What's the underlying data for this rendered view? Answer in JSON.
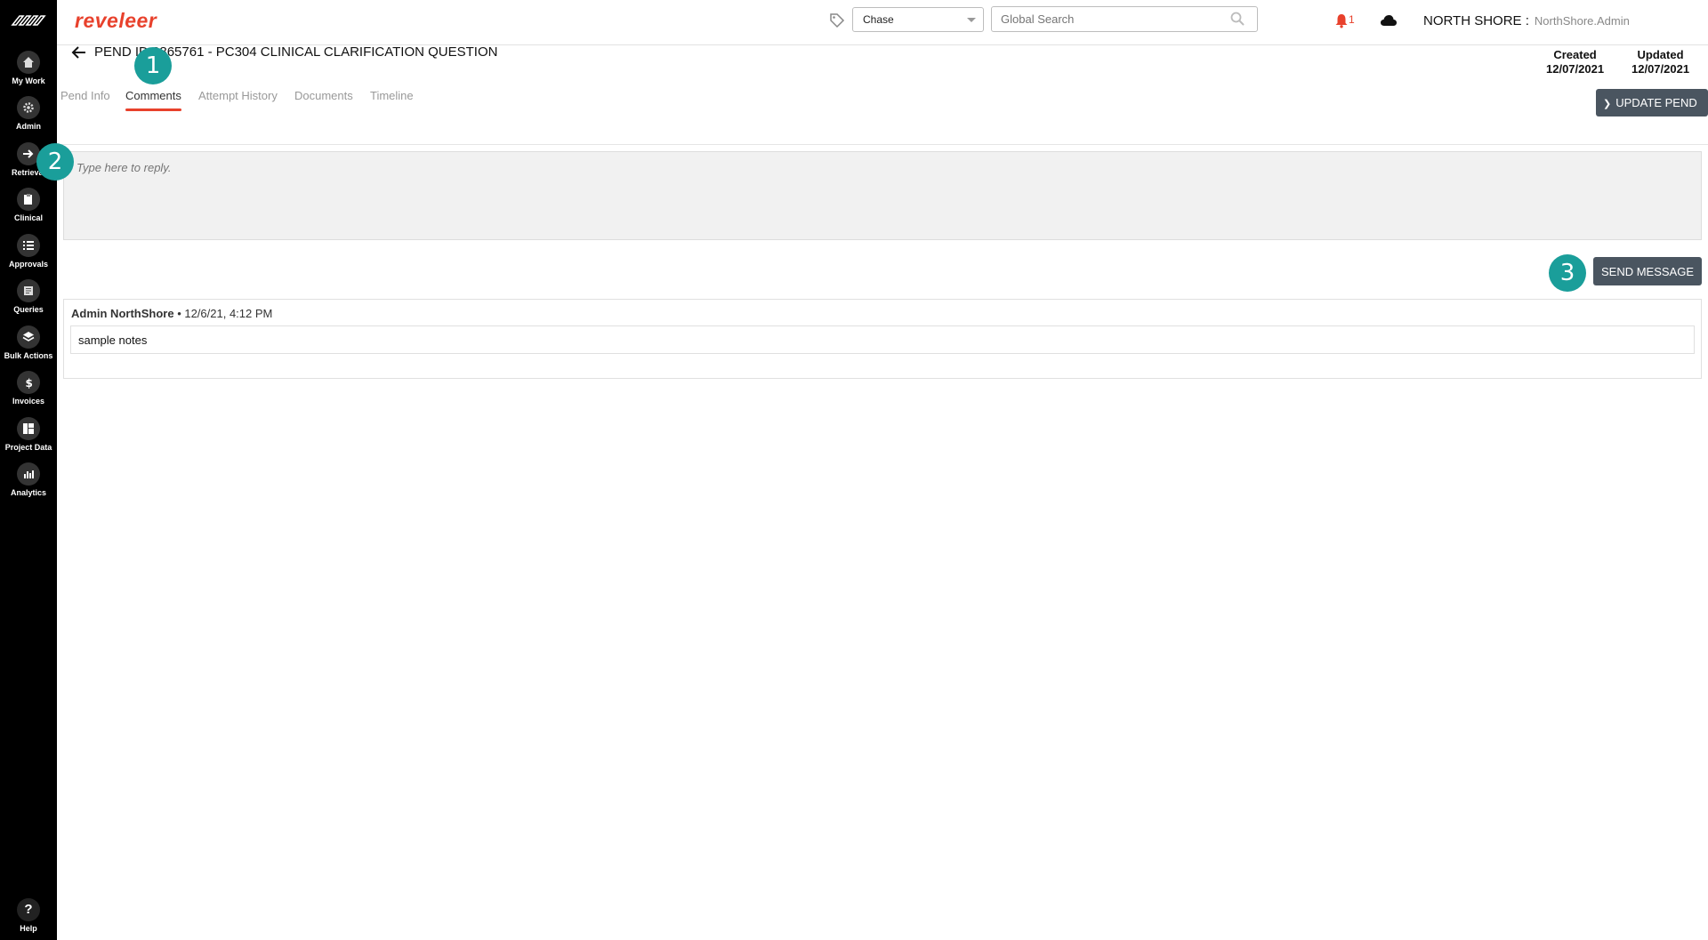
{
  "header": {
    "brand": "reveleer",
    "chase_select": "Chase",
    "search_placeholder": "Global Search",
    "notifications_count": "1",
    "org_name": "NORTH SHORE :",
    "user_name": "NorthShore.Admin"
  },
  "sidebar": {
    "items": [
      {
        "label": "My Work",
        "icon": "home-icon"
      },
      {
        "label": "Admin",
        "icon": "gear-icon"
      },
      {
        "label": "Retrieval",
        "icon": "arrow-right-icon"
      },
      {
        "label": "Clinical",
        "icon": "clipboard-icon"
      },
      {
        "label": "Approvals",
        "icon": "list-icon"
      },
      {
        "label": "Queries",
        "icon": "document-icon"
      },
      {
        "label": "Bulk Actions",
        "icon": "layers-icon"
      },
      {
        "label": "Invoices",
        "icon": "dollar-icon"
      },
      {
        "label": "Project Data",
        "icon": "grid-icon"
      },
      {
        "label": "Analytics",
        "icon": "chart-icon"
      }
    ],
    "help_label": "Help"
  },
  "page": {
    "title": "PEND ID 2865761 - PC304 CLINICAL CLARIFICATION QUESTION",
    "created_label": "Created",
    "created_date": "12/07/2021",
    "updated_label": "Updated",
    "updated_date": "12/07/2021",
    "update_button": "UPDATE PEND",
    "tabs": [
      {
        "label": "Pend Info",
        "active": false
      },
      {
        "label": "Comments",
        "active": true
      },
      {
        "label": "Attempt History",
        "active": false
      },
      {
        "label": "Documents",
        "active": false
      },
      {
        "label": "Timeline",
        "active": false
      }
    ]
  },
  "reply": {
    "placeholder": "Type here to reply."
  },
  "send_button": "SEND MESSAGE",
  "comments": [
    {
      "author": "Admin NorthShore",
      "timestamp": "• 12/6/21, 4:12 PM",
      "text": "sample notes"
    }
  ],
  "steps": [
    "1",
    "2",
    "3"
  ],
  "colors": {
    "brand": "#e8412c",
    "sidebar": "#000000",
    "button": "#4a5560",
    "step_marker": "#1a9e9a"
  }
}
